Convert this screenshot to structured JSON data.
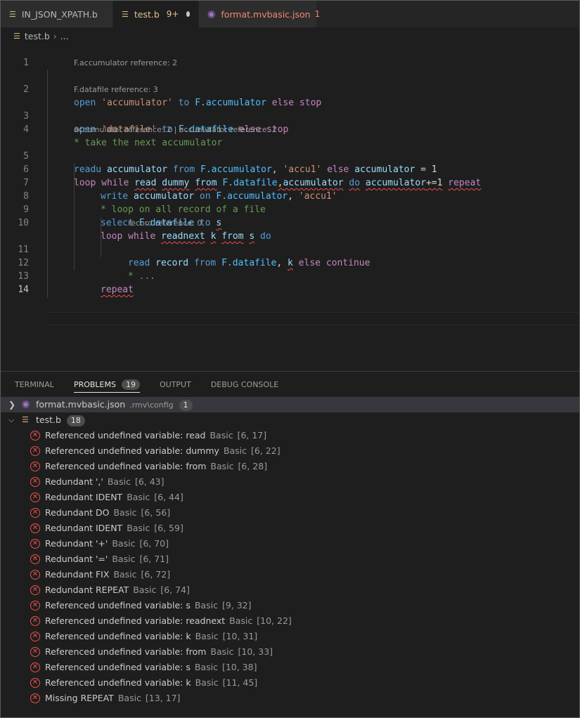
{
  "tabs": [
    {
      "label": "IN_JSON_XPATH.b",
      "icon": "file-lines-icon",
      "state": "inactive"
    },
    {
      "label": "test.b",
      "badge": "9+",
      "icon": "file-lines-icon",
      "state": "active"
    },
    {
      "label": "format.mvbasic.json",
      "badge": "1",
      "icon": "json-schema-icon",
      "state": "inactive"
    }
  ],
  "breadcrumb": {
    "file": "test.b",
    "ellipsis": "..."
  },
  "editor": {
    "line_numbers": [
      "1",
      "2",
      "3",
      "4",
      "5",
      "6",
      "7",
      "8",
      "9",
      "10",
      "11",
      "12",
      "13",
      "14"
    ],
    "hints": {
      "h1": "F.accumulator reference: 2",
      "h2": "F.datafile reference: 3",
      "h3": "accumulator reference: 2 | accumulator reference: 2",
      "h4": "record reference: 0"
    },
    "tokens": {
      "open": "open",
      "accumulator_str": "'accumulator'",
      "to": "to",
      "f_accumulator": "F.accumulator",
      "else": "else",
      "stop": "stop",
      "datafile_str": "'datafile'",
      "f_datafile": "F.datafile",
      "comment1": "* take the next accumulator",
      "readu": "readu",
      "accumulator": "accumulator",
      "from": "from",
      "comma": ",",
      "accu1_str": "'accu1'",
      "eq1": "= 1",
      "loop": "loop",
      "while": "while",
      "read": "read",
      "dummy": "dummy",
      "do": "do",
      "plus_eq": "+=1",
      "repeat": "repeat",
      "write": "write",
      "on": "on",
      "comment2": "* loop on all record of a file",
      "select": "select",
      "s": "s",
      "readnext": "readnext",
      "k": "k",
      "record": "record",
      "continue": "continue",
      "comment3": "* ..."
    }
  },
  "panel": {
    "tabs": [
      {
        "label": "TERMINAL"
      },
      {
        "label": "PROBLEMS",
        "count": "19"
      },
      {
        "label": "OUTPUT"
      },
      {
        "label": "DEBUG CONSOLE"
      }
    ],
    "groups": [
      {
        "file": "format.mvbasic.json",
        "dir": ".rmv\\config",
        "count": "1",
        "expanded": false
      },
      {
        "file": "test.b",
        "count": "18",
        "expanded": true
      }
    ],
    "problems": [
      {
        "message": "Referenced undefined variable: read",
        "source": "Basic",
        "pos": "[6, 17]"
      },
      {
        "message": "Referenced undefined variable: dummy",
        "source": "Basic",
        "pos": "[6, 22]"
      },
      {
        "message": "Referenced undefined variable: from",
        "source": "Basic",
        "pos": "[6, 28]"
      },
      {
        "message": "Redundant ','",
        "source": "Basic",
        "pos": "[6, 43]"
      },
      {
        "message": "Redundant IDENT",
        "source": "Basic",
        "pos": "[6, 44]"
      },
      {
        "message": "Redundant DO",
        "source": "Basic",
        "pos": "[6, 56]"
      },
      {
        "message": "Redundant IDENT",
        "source": "Basic",
        "pos": "[6, 59]"
      },
      {
        "message": "Redundant '+'",
        "source": "Basic",
        "pos": "[6, 70]"
      },
      {
        "message": "Redundant '='",
        "source": "Basic",
        "pos": "[6, 71]"
      },
      {
        "message": "Redundant FIX",
        "source": "Basic",
        "pos": "[6, 72]"
      },
      {
        "message": "Redundant REPEAT",
        "source": "Basic",
        "pos": "[6, 74]"
      },
      {
        "message": "Referenced undefined variable: s",
        "source": "Basic",
        "pos": "[9, 32]"
      },
      {
        "message": "Referenced undefined variable: readnext",
        "source": "Basic",
        "pos": "[10, 22]"
      },
      {
        "message": "Referenced undefined variable: k",
        "source": "Basic",
        "pos": "[10, 31]"
      },
      {
        "message": "Referenced undefined variable: from",
        "source": "Basic",
        "pos": "[10, 33]"
      },
      {
        "message": "Referenced undefined variable: s",
        "source": "Basic",
        "pos": "[10, 38]"
      },
      {
        "message": "Referenced undefined variable: k",
        "source": "Basic",
        "pos": "[11, 45]"
      },
      {
        "message": "Missing REPEAT",
        "source": "Basic",
        "pos": "[13, 17]"
      }
    ]
  }
}
